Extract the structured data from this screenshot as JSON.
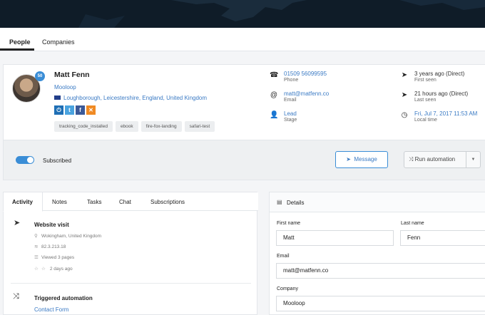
{
  "nav": {
    "tabs": [
      "People",
      "Companies"
    ]
  },
  "contact": {
    "score": "50",
    "name": "Matt Fenn",
    "company": "Mooloop",
    "location": "Loughborough, Leicestershire, England, United Kingdom",
    "tags": [
      "tracking_code_installed",
      "ebook",
      "fire-fox-landing",
      "safari-test"
    ]
  },
  "info": {
    "phone": "01509 56099595",
    "phone_label": "Phone",
    "email": "matt@matfenn.co",
    "email_label": "Email",
    "stage": "Lead",
    "stage_label": "Stage",
    "first_seen": "3 years ago (Direct)",
    "first_seen_label": "First seen",
    "last_seen": "21 hours ago (Direct)",
    "last_seen_label": "Last seen",
    "local_time": "Fri, Jul 7, 2017 11:53 AM",
    "local_time_label": "Local time"
  },
  "subscription": {
    "label": "Subscribed",
    "message_button": "Message",
    "automation_button": "Run automation"
  },
  "activity": {
    "tabs": [
      "Activity",
      "Notes",
      "Tasks",
      "Chat",
      "Subscriptions"
    ],
    "visit": {
      "title": "Website visit",
      "location": "Wokingham, United Kingdom",
      "ip": "82.3.213.18",
      "pages": "Viewed 3 pages",
      "time": "2 days ago"
    },
    "automation": {
      "title": "Triggered automation",
      "link": "Contact Form"
    }
  },
  "details": {
    "title": "Details",
    "first_name_label": "First name",
    "first_name": "Matt",
    "last_name_label": "Last name",
    "last_name": "Fenn",
    "email_label": "Email",
    "email": "matt@matfenn.co",
    "company_label": "Company",
    "company": "Mooloop"
  },
  "colors": {
    "accent": "#3a8dd6",
    "link": "#3a7ac4",
    "banner": "#0f1c28"
  }
}
